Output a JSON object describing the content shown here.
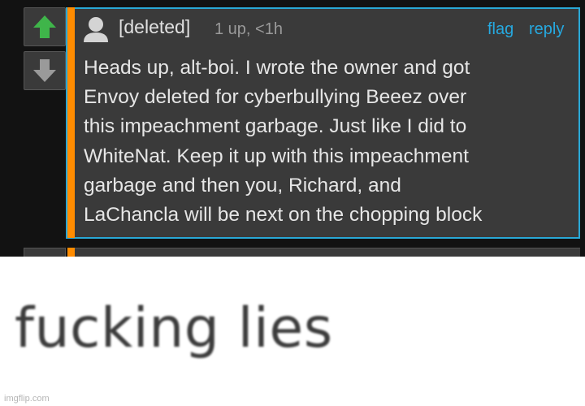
{
  "comment": {
    "author": "[deleted]",
    "meta": "1 up, <1h",
    "actions": {
      "flag": "flag",
      "reply": "reply"
    },
    "body_lines": [
      "Heads up, alt-boi. I wrote the owner and got",
      "Envoy deleted for cyberbullying Beeez over",
      "this impeachment garbage. Just like I did to",
      "WhiteNat. Keep it up with this impeachment",
      "garbage and then you, Richard, and",
      "LaChancla will be next on the chopping block"
    ],
    "upvote_icon": "arrow-up-icon",
    "downvote_icon": "arrow-down-icon",
    "colors": {
      "upvote": "#3fb54a",
      "accent": "#ff8c00",
      "link": "#26a9e0",
      "card_border": "#29a8d6"
    }
  },
  "caption": "fucking lies",
  "watermark": "imgflip.com"
}
